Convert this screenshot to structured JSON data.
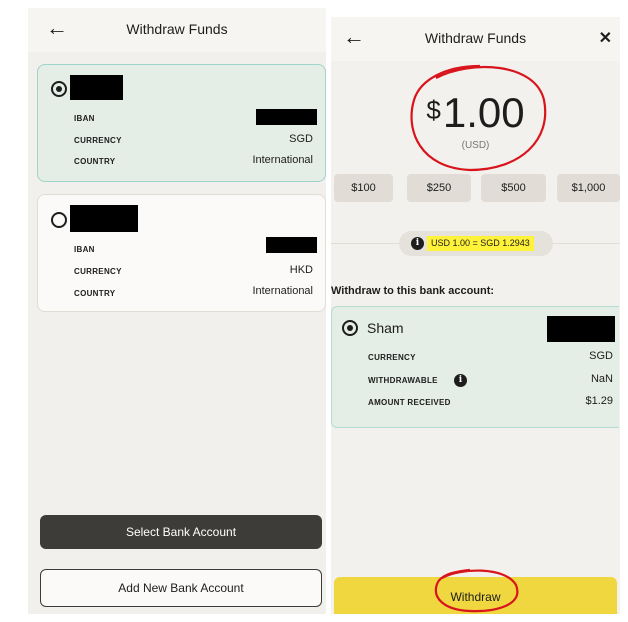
{
  "left": {
    "header": {
      "back_icon": "arrow-left-icon",
      "title": "Withdraw Funds"
    },
    "accounts": [
      {
        "selected": true,
        "rows": [
          {
            "label": "IBAN",
            "value": ""
          },
          {
            "label": "CURRENCY",
            "value": "SGD"
          },
          {
            "label": "COUNTRY",
            "value": "International"
          }
        ]
      },
      {
        "selected": false,
        "rows": [
          {
            "label": "IBAN",
            "value": ""
          },
          {
            "label": "CURRENCY",
            "value": "HKD"
          },
          {
            "label": "COUNTRY",
            "value": "International"
          }
        ]
      }
    ],
    "buttons": {
      "select": "Select Bank Account",
      "add": "Add New Bank Account"
    }
  },
  "right": {
    "header": {
      "back_icon": "arrow-left-icon",
      "title": "Withdraw Funds",
      "close": "✕"
    },
    "amount": {
      "symbol": "$",
      "value": "1.00",
      "unit": "(USD)"
    },
    "presets": [
      "$100",
      "$250",
      "$500",
      "$1,000"
    ],
    "rate": {
      "icon": "info-icon",
      "text": "USD 1.00 = SGD 1.2943"
    },
    "section_title": "Withdraw to this bank account:",
    "account": {
      "name": "Sham",
      "rows": [
        {
          "label": "CURRENCY",
          "value": "SGD"
        },
        {
          "label": "WITHDRAWABLE",
          "value": "NaN"
        },
        {
          "label": "AMOUNT RECEIVED",
          "value": "$1.29"
        }
      ]
    },
    "withdraw_button": "Withdraw"
  },
  "colors": {
    "selected_card": "#e4ede6",
    "card_border": "#9fd3cb",
    "dark_button": "#3e3c38",
    "withdraw_button": "#f0d63f",
    "highlight": "#fff23b",
    "annotation_red": "#d8141c"
  }
}
